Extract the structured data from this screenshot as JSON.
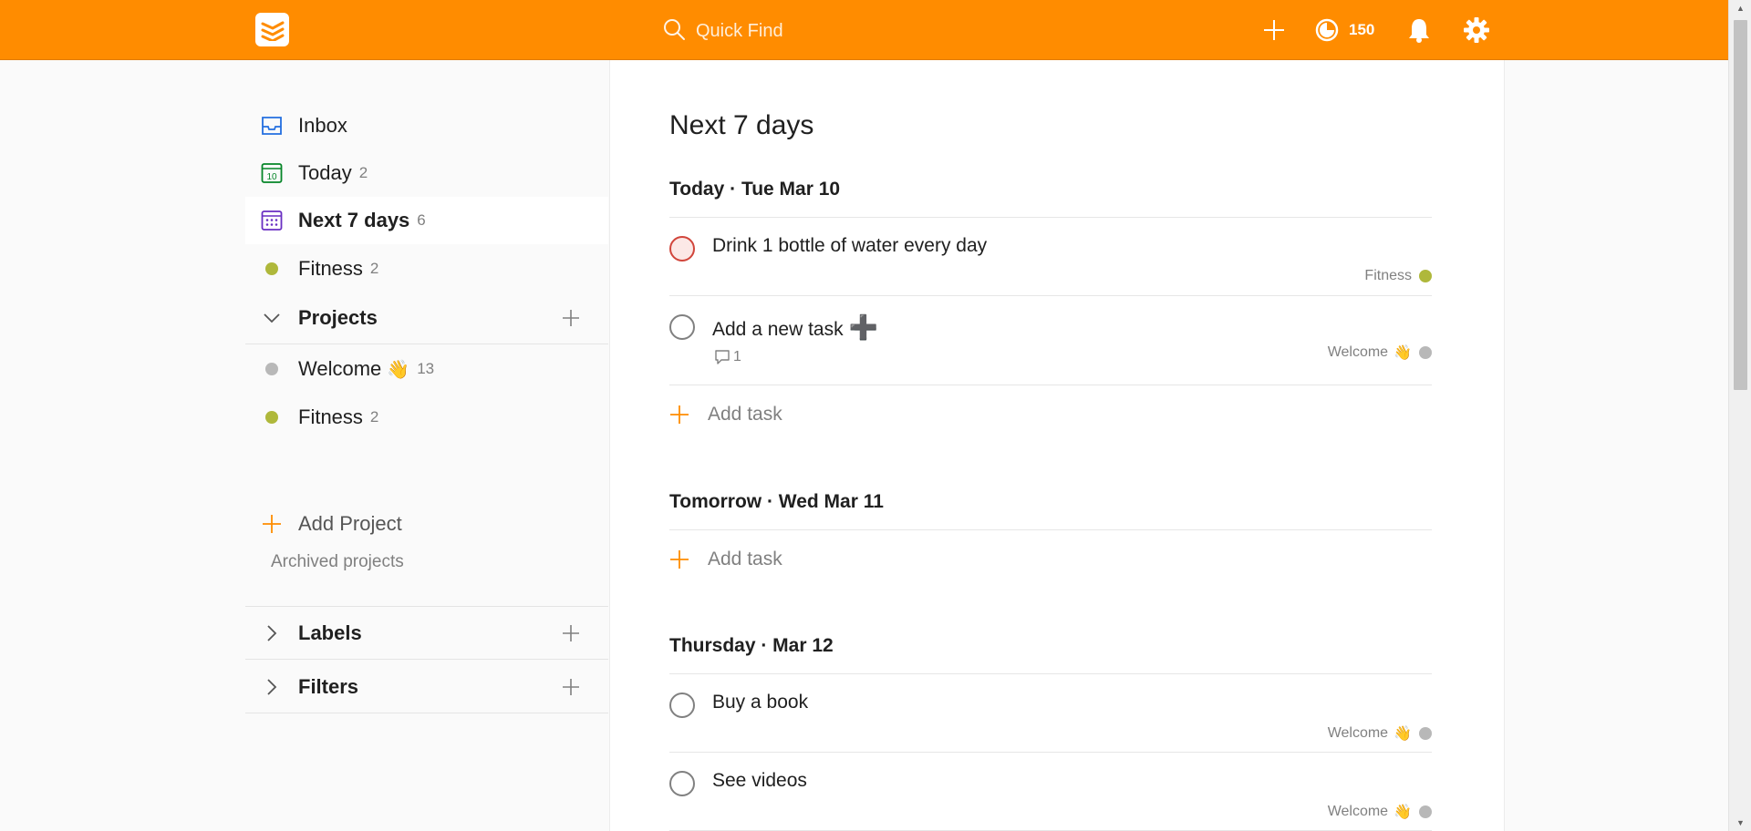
{
  "topbar": {
    "search_placeholder": "Quick Find",
    "karma_count": "150",
    "accent": "#ff8c00"
  },
  "sidebar": {
    "inbox": {
      "label": "Inbox",
      "icon": "inbox-icon"
    },
    "today": {
      "label": "Today",
      "count": "2",
      "icon": "calendar-today-icon"
    },
    "next7": {
      "label": "Next 7 days",
      "count": "6",
      "icon": "calendar-week-icon"
    },
    "fitness_label": {
      "label": "Fitness",
      "count": "2",
      "color": "#afb83b"
    },
    "projects_header": "Projects",
    "projects": [
      {
        "label": "Welcome",
        "emoji": "👋",
        "count": "13",
        "color": "#b8b8b8"
      },
      {
        "label": "Fitness",
        "count": "2",
        "color": "#afb83b"
      }
    ],
    "add_project": "Add Project",
    "archived": "Archived projects",
    "labels_header": "Labels",
    "filters_header": "Filters"
  },
  "main": {
    "title": "Next 7 days",
    "add_task_label": "Add task",
    "days": [
      {
        "heading": "Today · Tue Mar 10",
        "tasks": [
          {
            "text": "Drink 1 bottle of water every day",
            "project": "Fitness",
            "priority": "p1"
          },
          {
            "text": "Add a new task",
            "suffix": "➕",
            "project": "Welcome",
            "emoji": "👋",
            "comments": "1"
          }
        ]
      },
      {
        "heading": "Tomorrow · Wed Mar 11",
        "tasks": []
      },
      {
        "heading": "Thursday · Mar 12",
        "tasks": [
          {
            "text": "Buy a book",
            "project": "Welcome",
            "emoji": "👋"
          },
          {
            "text": "See videos",
            "project": "Welcome",
            "emoji": "👋"
          }
        ]
      }
    ]
  }
}
